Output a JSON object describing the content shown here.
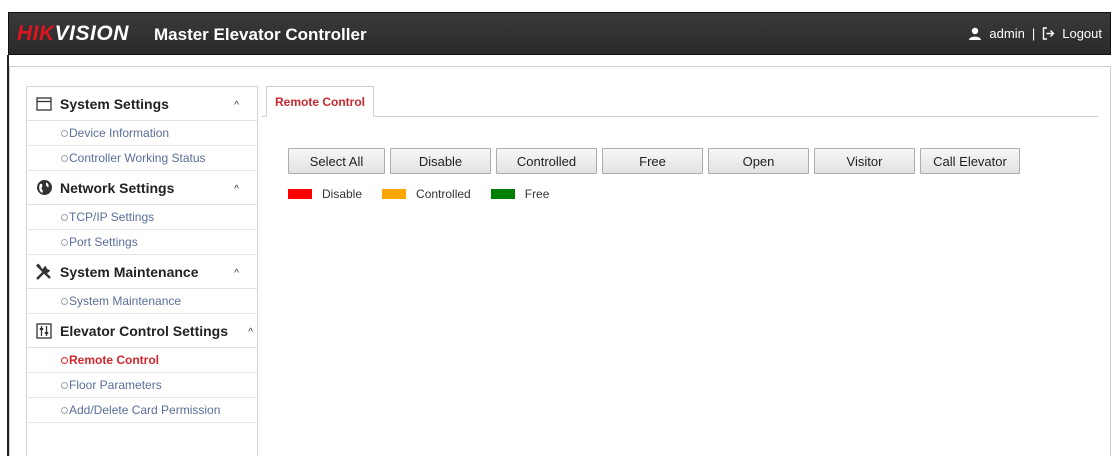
{
  "header": {
    "logo_hik": "HIK",
    "logo_vision": "VISION",
    "title": "Master Elevator Controller",
    "user": "admin",
    "separator": "|",
    "logout": "Logout"
  },
  "sidebar": [
    {
      "title": "System Settings",
      "icon": "window-icon",
      "caret": "^",
      "items": [
        "Device Information",
        "Controller Working Status"
      ]
    },
    {
      "title": "Network Settings",
      "icon": "globe-icon",
      "caret": "^",
      "items": [
        "TCP/IP Settings",
        "Port Settings"
      ]
    },
    {
      "title": "System Maintenance",
      "icon": "tools-icon",
      "caret": "^",
      "items": [
        "System Maintenance"
      ]
    },
    {
      "title": "Elevator Control Settings",
      "icon": "sliders-icon",
      "caret": "^",
      "items": [
        "Remote Control",
        "Floor Parameters",
        "Add/Delete Card Permission"
      ],
      "active_item": "Remote Control"
    }
  ],
  "tab": {
    "label": "Remote Control"
  },
  "buttons": [
    "Select All",
    "Disable",
    "Controlled",
    "Free",
    "Open",
    "Visitor",
    "Call Elevator"
  ],
  "legend": [
    {
      "label": "Disable",
      "color": "#ff0000"
    },
    {
      "label": "Controlled",
      "color": "#ffa500"
    },
    {
      "label": "Free",
      "color": "#008000"
    }
  ],
  "colors": {
    "accent": "#d3262e",
    "brand_red": "#e0141e",
    "header_bg": "#2f2f2f",
    "link": "#5a6e9a"
  }
}
